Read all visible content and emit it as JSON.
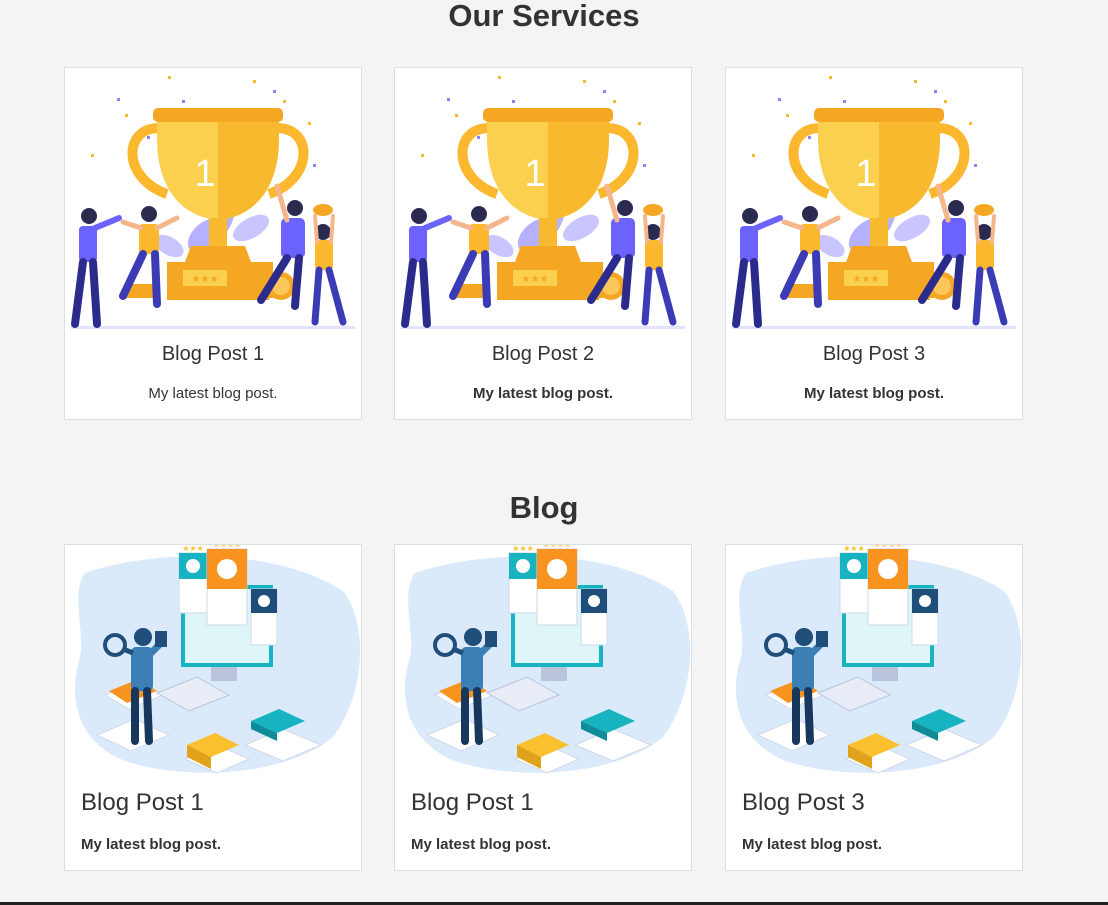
{
  "services": {
    "title": "Our Services",
    "cards": [
      {
        "title": "Blog Post 1",
        "text": "My latest blog post.",
        "trophy_number": "1"
      },
      {
        "title": "Blog Post 2",
        "text": "My latest blog post.",
        "trophy_number": "1"
      },
      {
        "title": "Blog Post 3",
        "text": "My latest blog post.",
        "trophy_number": "1"
      }
    ]
  },
  "blog": {
    "title": "Blog",
    "cards": [
      {
        "title": "Blog Post 1",
        "text": "My latest blog post."
      },
      {
        "title": "Blog Post 1",
        "text": "My latest blog post."
      },
      {
        "title": "Blog Post 3",
        "text": "My latest blog post."
      }
    ]
  },
  "colors": {
    "page_bg": "#f4f4f4",
    "card_bg": "#ffffff",
    "card_border": "#dedede",
    "text": "#333333",
    "trophy_gold": "#fbb72e",
    "accent_purple": "#6c63ff",
    "accent_teal": "#17b3c1",
    "accent_orange": "#f7931e"
  }
}
